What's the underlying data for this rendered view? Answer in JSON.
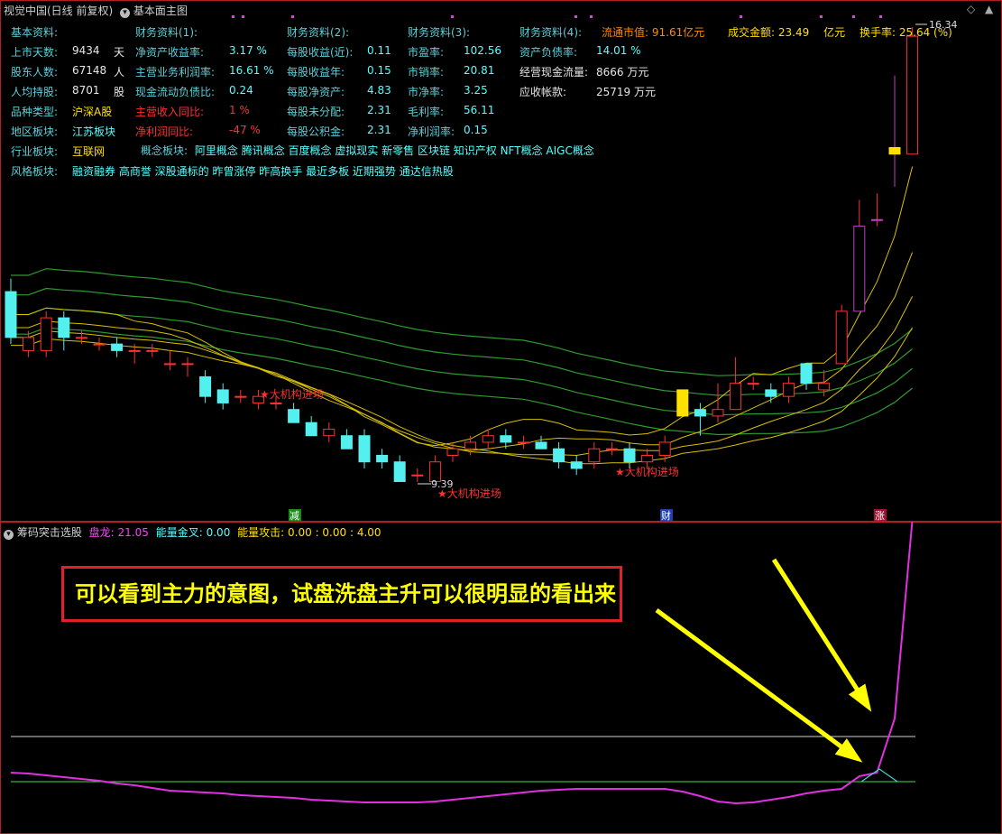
{
  "header": {
    "title": "视觉中国(日线 前复权)",
    "main_indicator": "基本面主图"
  },
  "fundamentals": {
    "col1": {
      "title": "基本资料:",
      "rows": [
        {
          "label": "上市天数:",
          "value": "9434",
          "unit": "天"
        },
        {
          "label": "股东人数:",
          "value": "67148",
          "unit": "人"
        },
        {
          "label": "人均持股:",
          "value": "8701",
          "unit": "股"
        },
        {
          "label": "品种类型:",
          "value": "沪深A股",
          "unit": ""
        },
        {
          "label": "地区板块:",
          "value": "江苏板块",
          "unit": ""
        },
        {
          "label": "行业板块:",
          "value": "互联网",
          "unit": ""
        },
        {
          "label": "风格板块:",
          "value": "融资融券 高商誉 深股通标的 昨曾涨停 昨高换手 最近多板 近期强势 通达信热股",
          "unit": ""
        }
      ]
    },
    "col2": {
      "title": "财务资料(1):",
      "rows": [
        {
          "label": "净资产收益率:",
          "value": "3.17 %"
        },
        {
          "label": "主营业务利润率:",
          "value": "16.61 %"
        },
        {
          "label": "现金流动负债比:",
          "value": "0.24"
        },
        {
          "label": "主营收入同比:",
          "value": "1 %"
        },
        {
          "label": "净利润同比:",
          "value": "-47 %"
        }
      ]
    },
    "concept": {
      "label": "概念板块:",
      "value": "阿里概念 腾讯概念 百度概念 虚拟现实 新零售 区块链 知识产权 NFT概念 AIGC概念"
    },
    "col3": {
      "title": "财务资料(2):",
      "rows": [
        {
          "label": "每股收益(近):",
          "value": "0.11"
        },
        {
          "label": "每股收益年:",
          "value": "0.15"
        },
        {
          "label": "每股净资产:",
          "value": "4.83"
        },
        {
          "label": "每股未分配:",
          "value": "2.31"
        },
        {
          "label": "每股公积金:",
          "value": "2.31"
        }
      ]
    },
    "col4": {
      "title": "财务资料(3):",
      "rows": [
        {
          "label": "市盈率:",
          "value": "102.56"
        },
        {
          "label": "市销率:",
          "value": "20.81"
        },
        {
          "label": "市净率:",
          "value": "3.25"
        },
        {
          "label": "毛利率:",
          "value": "56.11"
        },
        {
          "label": "净利润率:",
          "value": "0.15"
        }
      ]
    },
    "col5": {
      "title": "财务资料(4):",
      "rows": [
        {
          "label": "资产负债率:",
          "value": "14.01 %"
        },
        {
          "label": "经营现金流量:",
          "value": "8666 万元"
        },
        {
          "label": "应收帐款:",
          "value": "25719 万元"
        }
      ]
    },
    "market": {
      "circ_cap_label": "流通市值:",
      "circ_cap_value": "91.61亿元",
      "turnover_amount_label": "成交金额:",
      "turnover_amount_value": "23.49",
      "turnover_amount_unit": "亿元",
      "turnover_rate_label": "换手率:",
      "turnover_rate_value": "25.64 (%)"
    }
  },
  "main_chart": {
    "price_high_label": "16.34",
    "price_low_label": "9.39",
    "signals": [
      "★大机构进场",
      "★大机构进场",
      "★大机构进场"
    ],
    "markers": [
      "减",
      "财",
      "涨"
    ]
  },
  "sub_chart": {
    "title": "筹码突击选股",
    "panlong_label": "盘龙:",
    "panlong_value": "21.05",
    "golden_cross_label": "能量金叉:",
    "golden_cross_value": "0.00",
    "attack_label": "能量攻击:",
    "attack_value": "0.00 : 0.00 : 4.00"
  },
  "annotation": "可以看到主力的意图，试盘洗盘主升可以很明显的看出来",
  "chart_data": {
    "type": "candlestick",
    "candles": [
      {
        "o": 12.3,
        "c": 11.6,
        "h": 12.5,
        "l": 11.5
      },
      {
        "o": 11.4,
        "c": 11.6,
        "h": 11.7,
        "l": 11.3
      },
      {
        "o": 11.4,
        "c": 11.9,
        "h": 12.0,
        "l": 11.3
      },
      {
        "o": 11.9,
        "c": 11.6,
        "h": 12.0,
        "l": 11.4
      },
      {
        "o": 11.6,
        "c": 11.6,
        "h": 11.7,
        "l": 11.5
      },
      {
        "o": 11.5,
        "c": 11.5,
        "h": 11.6,
        "l": 11.4
      },
      {
        "o": 11.5,
        "c": 11.4,
        "h": 11.6,
        "l": 11.3
      },
      {
        "o": 11.4,
        "c": 11.4,
        "h": 11.5,
        "l": 11.2
      },
      {
        "o": 11.4,
        "c": 11.4,
        "h": 11.5,
        "l": 11.3
      },
      {
        "o": 11.2,
        "c": 11.2,
        "h": 11.4,
        "l": 11.1
      },
      {
        "o": 11.2,
        "c": 11.2,
        "h": 11.3,
        "l": 11.0
      },
      {
        "o": 11.0,
        "c": 10.7,
        "h": 11.1,
        "l": 10.6
      },
      {
        "o": 10.8,
        "c": 10.6,
        "h": 10.9,
        "l": 10.5
      },
      {
        "o": 10.7,
        "c": 10.7,
        "h": 10.8,
        "l": 10.6
      },
      {
        "o": 10.6,
        "c": 10.7,
        "h": 10.8,
        "l": 10.5
      },
      {
        "o": 10.6,
        "c": 10.6,
        "h": 10.7,
        "l": 10.5
      },
      {
        "o": 10.5,
        "c": 10.3,
        "h": 10.6,
        "l": 10.3
      },
      {
        "o": 10.3,
        "c": 10.1,
        "h": 10.4,
        "l": 10.1
      },
      {
        "o": 10.1,
        "c": 10.2,
        "h": 10.3,
        "l": 10.0
      },
      {
        "o": 10.1,
        "c": 9.9,
        "h": 10.2,
        "l": 9.9
      },
      {
        "o": 10.1,
        "c": 9.7,
        "h": 10.2,
        "l": 9.6
      },
      {
        "o": 9.8,
        "c": 9.7,
        "h": 9.9,
        "l": 9.6
      },
      {
        "o": 9.7,
        "c": 9.4,
        "h": 9.8,
        "l": 9.4
      },
      {
        "o": 9.5,
        "c": 9.5,
        "h": 9.6,
        "l": 9.39
      },
      {
        "o": 9.4,
        "c": 9.7,
        "h": 9.8,
        "l": 9.4
      },
      {
        "o": 9.8,
        "c": 9.9,
        "h": 10.0,
        "l": 9.7
      },
      {
        "o": 9.9,
        "c": 10.0,
        "h": 10.1,
        "l": 9.8
      },
      {
        "o": 10.0,
        "c": 10.1,
        "h": 10.2,
        "l": 9.9
      },
      {
        "o": 10.1,
        "c": 10.0,
        "h": 10.2,
        "l": 9.9
      },
      {
        "o": 10.0,
        "c": 10.0,
        "h": 10.1,
        "l": 9.9
      },
      {
        "o": 10.0,
        "c": 9.9,
        "h": 10.1,
        "l": 9.9
      },
      {
        "o": 9.9,
        "c": 9.7,
        "h": 10.0,
        "l": 9.6
      },
      {
        "o": 9.7,
        "c": 9.6,
        "h": 9.8,
        "l": 9.5
      },
      {
        "o": 9.7,
        "c": 9.9,
        "h": 10.0,
        "l": 9.6
      },
      {
        "o": 9.9,
        "c": 9.9,
        "h": 10.0,
        "l": 9.8
      },
      {
        "o": 9.9,
        "c": 9.7,
        "h": 10.0,
        "l": 9.6
      },
      {
        "o": 9.7,
        "c": 9.8,
        "h": 9.9,
        "l": 9.6
      },
      {
        "o": 9.8,
        "c": 10.0,
        "h": 10.1,
        "l": 9.7
      },
      {
        "o": 10.4,
        "c": 10.8,
        "h": 10.8,
        "l": 10.4
      },
      {
        "o": 10.5,
        "c": 10.4,
        "h": 10.6,
        "l": 10.1
      },
      {
        "o": 10.4,
        "c": 10.5,
        "h": 10.9,
        "l": 10.3
      },
      {
        "o": 10.5,
        "c": 10.9,
        "h": 11.3,
        "l": 10.5
      },
      {
        "o": 10.9,
        "c": 10.9,
        "h": 11.0,
        "l": 10.8
      },
      {
        "o": 10.8,
        "c": 10.7,
        "h": 10.9,
        "l": 10.6
      },
      {
        "o": 10.7,
        "c": 10.9,
        "h": 11.0,
        "l": 10.6
      },
      {
        "o": 11.2,
        "c": 10.9,
        "h": 11.2,
        "l": 10.8
      },
      {
        "o": 10.8,
        "c": 10.9,
        "h": 11.1,
        "l": 10.7
      },
      {
        "o": 11.2,
        "c": 12.0,
        "h": 12.1,
        "l": 11.2
      },
      {
        "o": 12.0,
        "c": 13.3,
        "h": 13.7,
        "l": 12.0
      },
      {
        "o": 13.4,
        "c": 13.4,
        "h": 13.8,
        "l": 13.3
      },
      {
        "o": 14.5,
        "c": 14.4,
        "h": 15.6,
        "l": 13.9
      },
      {
        "o": 14.4,
        "c": 16.2,
        "h": 16.34,
        "l": 14.4
      }
    ]
  }
}
